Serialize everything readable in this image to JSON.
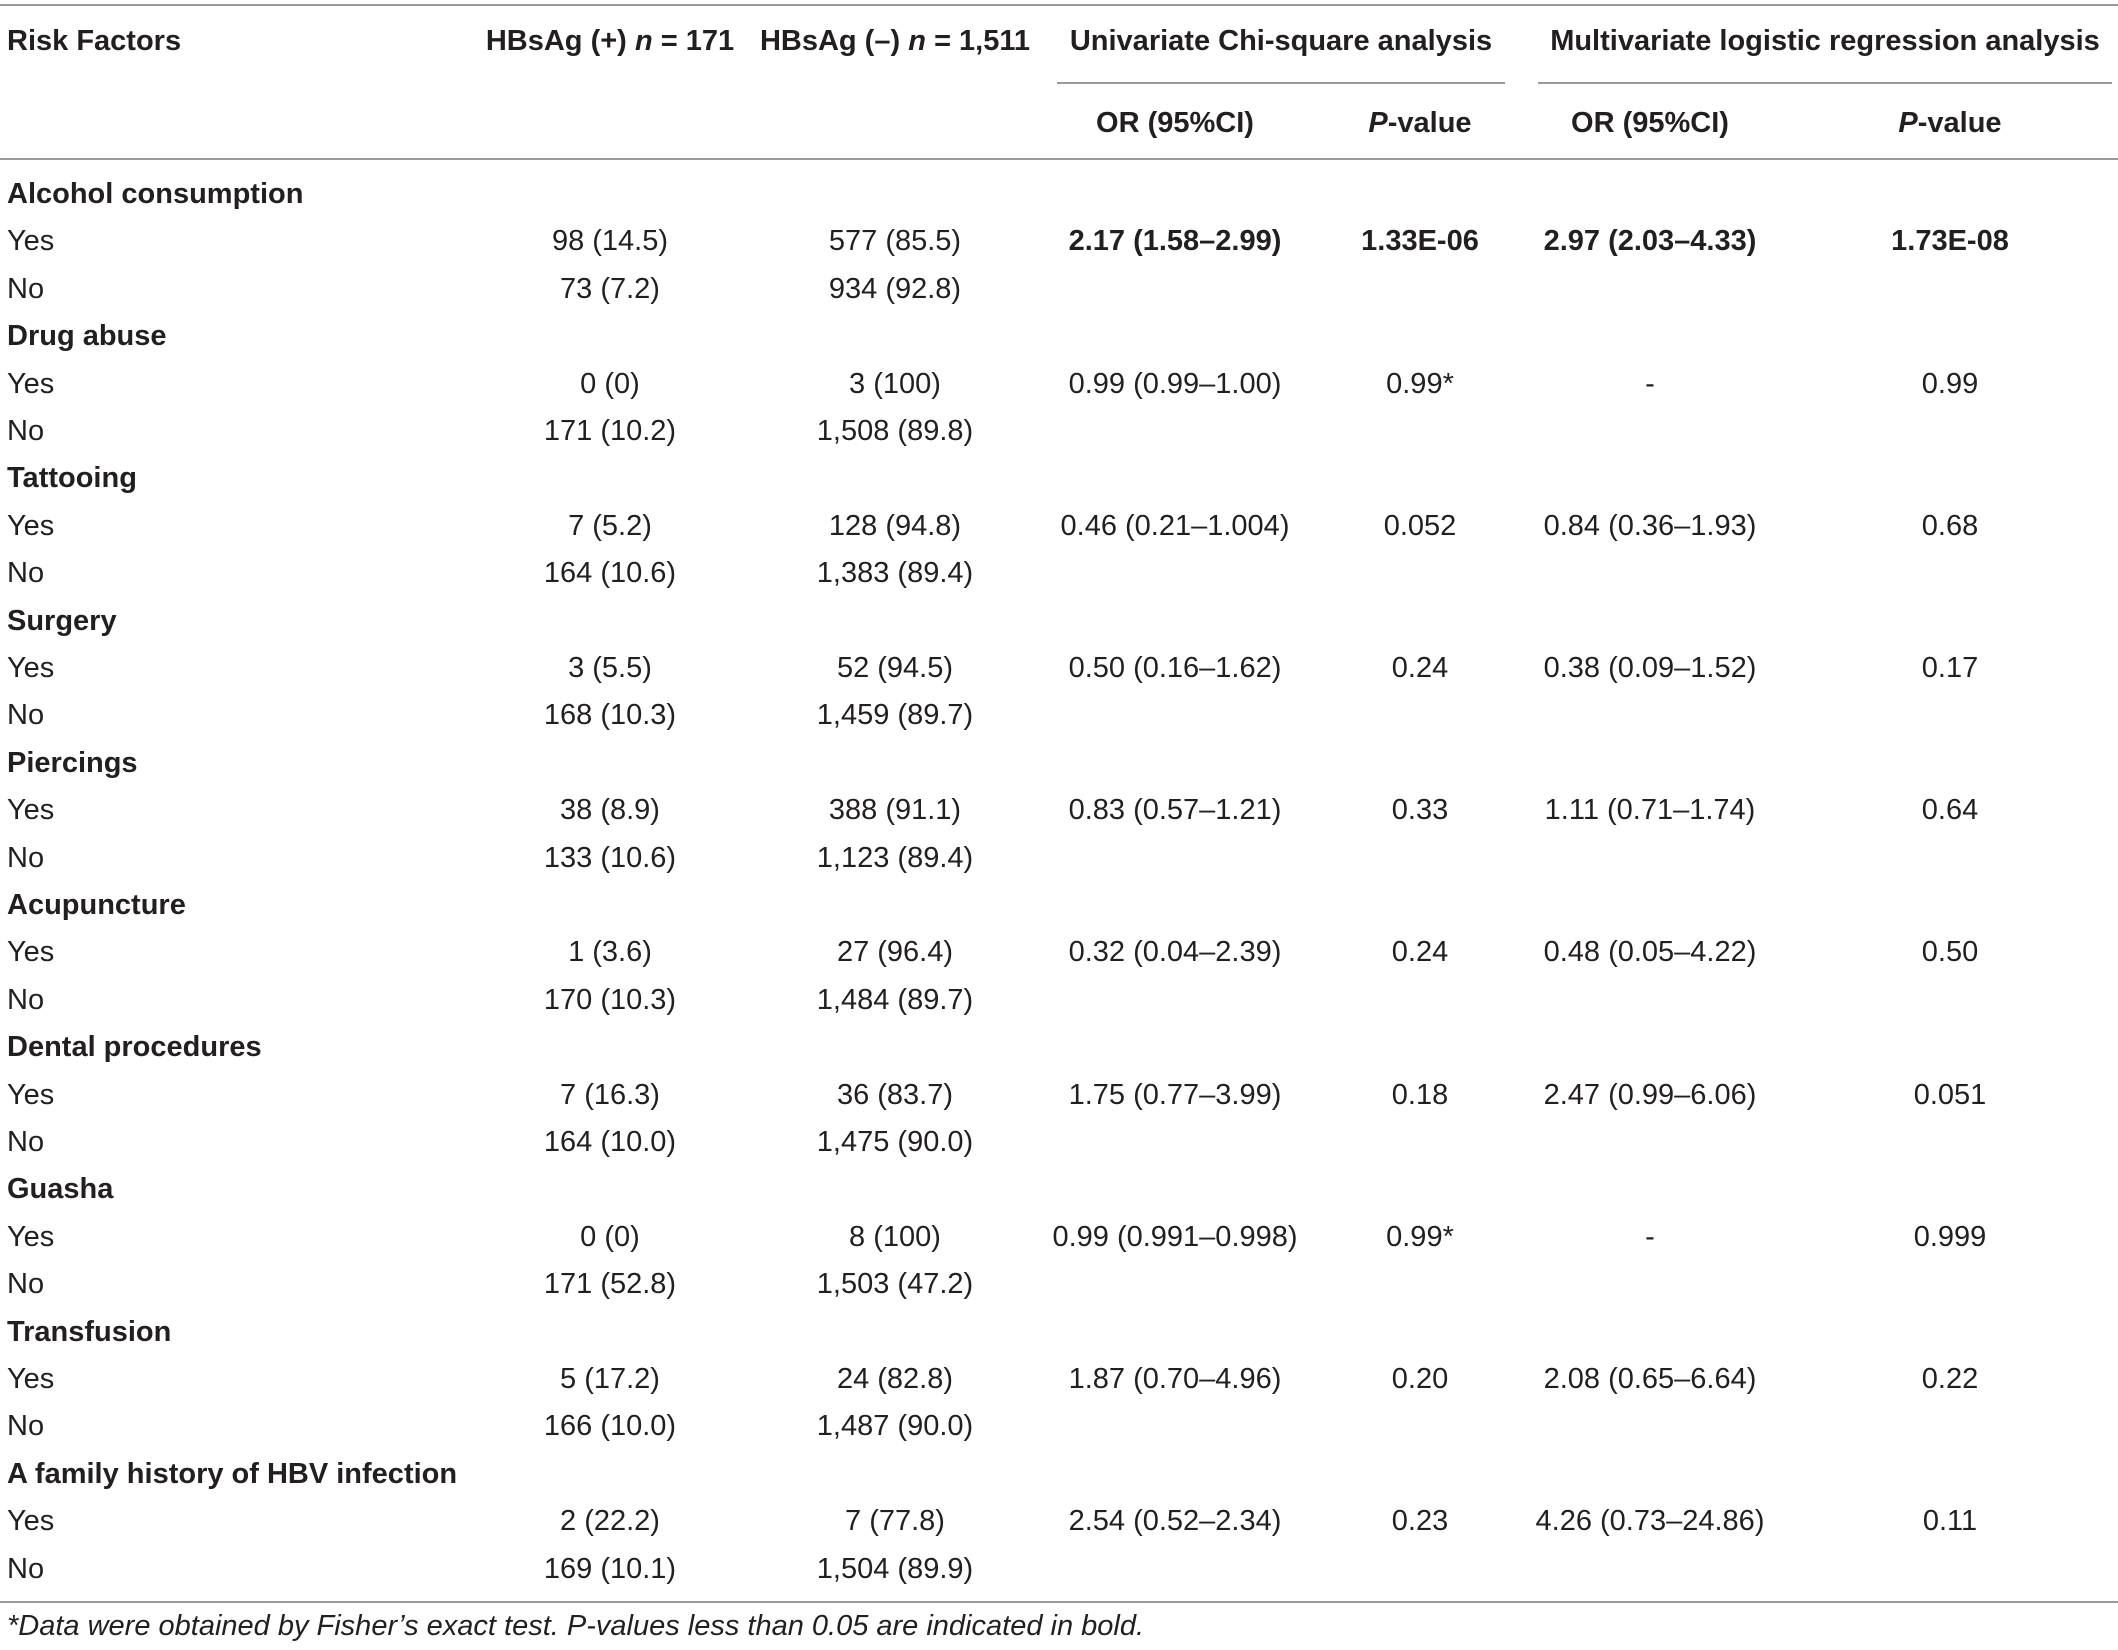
{
  "header": {
    "risk_factors": "Risk Factors",
    "pos": {
      "label": "HBsAg (+)",
      "n_italic": "n",
      "n_value": "= 171"
    },
    "neg": {
      "label": "HBsAg (–)",
      "n_italic": "n",
      "n_value": "= 1,511"
    },
    "univariate": "Univariate Chi-square analysis",
    "multivariate": "Multivariate logistic regression analysis",
    "or_uni": "OR (95%CI)",
    "p_uni": {
      "italic": "P",
      "rest": "-value"
    },
    "or_multi": "OR (95%CI)",
    "p_multi": {
      "italic": "P",
      "rest": "-value"
    }
  },
  "groups": [
    {
      "name": "Alcohol consumption",
      "bold_stats": true,
      "yes": {
        "label": "Yes",
        "pos": "98 (14.5)",
        "neg": "577 (85.5)",
        "or_uni": "2.17 (1.58–2.99)",
        "p_uni": "1.33E-06",
        "or_multi": "2.97 (2.03–4.33)",
        "p_multi": "1.73E-08"
      },
      "no": {
        "label": "No",
        "pos": "73 (7.2)",
        "neg": "934 (92.8)"
      }
    },
    {
      "name": "Drug abuse",
      "bold_stats": false,
      "yes": {
        "label": "Yes",
        "pos": "0 (0)",
        "neg": "3 (100)",
        "or_uni": "0.99 (0.99–1.00)",
        "p_uni": "0.99*",
        "or_multi": "-",
        "p_multi": "0.99"
      },
      "no": {
        "label": "No",
        "pos": "171 (10.2)",
        "neg": "1,508 (89.8)"
      }
    },
    {
      "name": "Tattooing",
      "bold_stats": false,
      "yes": {
        "label": "Yes",
        "pos": "7 (5.2)",
        "neg": "128 (94.8)",
        "or_uni": "0.46 (0.21–1.004)",
        "p_uni": "0.052",
        "or_multi": "0.84 (0.36–1.93)",
        "p_multi": "0.68"
      },
      "no": {
        "label": "No",
        "pos": "164 (10.6)",
        "neg": "1,383 (89.4)"
      }
    },
    {
      "name": "Surgery",
      "bold_stats": false,
      "yes": {
        "label": "Yes",
        "pos": "3 (5.5)",
        "neg": "52 (94.5)",
        "or_uni": "0.50 (0.16–1.62)",
        "p_uni": "0.24",
        "or_multi": "0.38 (0.09–1.52)",
        "p_multi": "0.17"
      },
      "no": {
        "label": "No",
        "pos": "168 (10.3)",
        "neg": "1,459 (89.7)"
      }
    },
    {
      "name": "Piercings",
      "bold_stats": false,
      "yes": {
        "label": "Yes",
        "pos": "38 (8.9)",
        "neg": "388 (91.1)",
        "or_uni": "0.83 (0.57–1.21)",
        "p_uni": "0.33",
        "or_multi": "1.11 (0.71–1.74)",
        "p_multi": "0.64"
      },
      "no": {
        "label": "No",
        "pos": "133 (10.6)",
        "neg": "1,123 (89.4)"
      }
    },
    {
      "name": "Acupuncture",
      "bold_stats": false,
      "yes": {
        "label": "Yes",
        "pos": "1 (3.6)",
        "neg": "27 (96.4)",
        "or_uni": "0.32 (0.04–2.39)",
        "p_uni": "0.24",
        "or_multi": "0.48 (0.05–4.22)",
        "p_multi": "0.50"
      },
      "no": {
        "label": "No",
        "pos": "170 (10.3)",
        "neg": "1,484 (89.7)"
      }
    },
    {
      "name": "Dental procedures",
      "bold_stats": false,
      "yes": {
        "label": "Yes",
        "pos": "7 (16.3)",
        "neg": "36 (83.7)",
        "or_uni": "1.75 (0.77–3.99)",
        "p_uni": "0.18",
        "or_multi": "2.47 (0.99–6.06)",
        "p_multi": "0.051"
      },
      "no": {
        "label": "No",
        "pos": "164 (10.0)",
        "neg": "1,475 (90.0)"
      }
    },
    {
      "name": "Guasha",
      "bold_stats": false,
      "yes": {
        "label": "Yes",
        "pos": "0 (0)",
        "neg": "8 (100)",
        "or_uni": "0.99 (0.991–0.998)",
        "p_uni": "0.99*",
        "or_multi": "-",
        "p_multi": "0.999"
      },
      "no": {
        "label": "No",
        "pos": "171 (52.8)",
        "neg": "1,503 (47.2)"
      }
    },
    {
      "name": "Transfusion",
      "bold_stats": false,
      "yes": {
        "label": "Yes",
        "pos": "5 (17.2)",
        "neg": "24 (82.8)",
        "or_uni": "1.87 (0.70–4.96)",
        "p_uni": "0.20",
        "or_multi": "2.08 (0.65–6.64)",
        "p_multi": "0.22"
      },
      "no": {
        "label": "No",
        "pos": "166 (10.0)",
        "neg": "1,487 (90.0)"
      }
    },
    {
      "name": "A family history of HBV infection",
      "bold_stats": false,
      "yes": {
        "label": "Yes",
        "pos": "2 (22.2)",
        "neg": "7 (77.8)",
        "or_uni": "2.54 (0.52–2.34)",
        "p_uni": "0.23",
        "or_multi": "4.26 (0.73–24.86)",
        "p_multi": "0.11"
      },
      "no": {
        "label": "No",
        "pos": "169 (10.1)",
        "neg": "1,504 (89.9)"
      }
    }
  ],
  "footnote": "*Data were obtained by Fisher’s exact test. P-values less than 0.05 are indicated in bold."
}
